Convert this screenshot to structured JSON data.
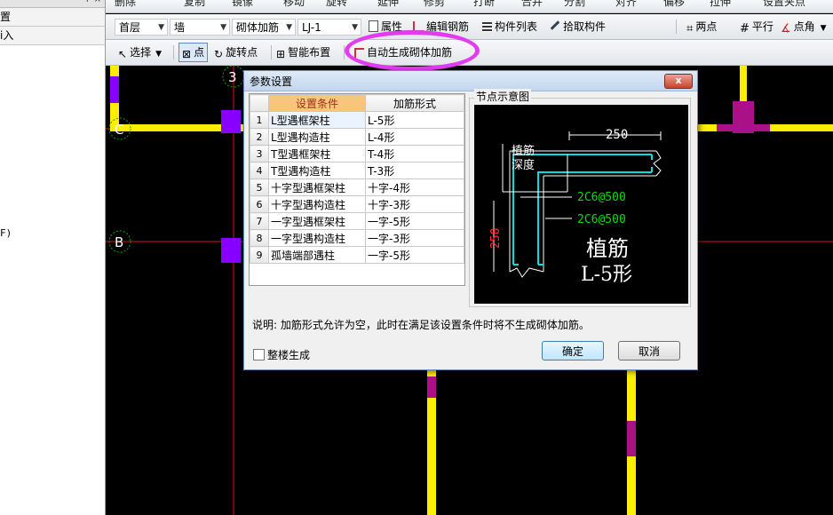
{
  "left_panel": {
    "row1": "置",
    "row2": "i入",
    "note": "F)",
    "close": "+ ×"
  },
  "toolbar1": {
    "items": [
      "删除",
      "复制",
      "镜像",
      "移动",
      "旋转",
      "延伸",
      "修剪",
      "打断",
      "合并",
      "分割",
      "对齐",
      "偏移",
      "拉伸",
      "设置夹点"
    ]
  },
  "toolbar2": {
    "floor": "首层",
    "category": "墙",
    "type": "砌体加筋",
    "component": "LJ-1",
    "attr": "属性",
    "edit_rebar": "编辑钢筋",
    "list": "构件列表",
    "pick": "拾取构件",
    "two_points": "两点",
    "parallel": "平行",
    "point_angle": "点角"
  },
  "toolbar3": {
    "select": "选择",
    "point": "点",
    "rotate_point": "旋转点",
    "smart": "智能布置",
    "auto": "自动生成砌体加筋"
  },
  "axes": {
    "a3": "3",
    "aC": "C",
    "aB": "B"
  },
  "dialog": {
    "title": "参数设置",
    "close": "x",
    "col_condition": "设置条件",
    "col_form": "加筋形式",
    "rows": [
      {
        "n": "1",
        "cond": "L型遇框架柱",
        "form": "L-5形"
      },
      {
        "n": "2",
        "cond": "L型遇构造柱",
        "form": "L-4形"
      },
      {
        "n": "3",
        "cond": "T型遇框架柱",
        "form": "T-4形"
      },
      {
        "n": "4",
        "cond": "T型遇构造柱",
        "form": "T-3形"
      },
      {
        "n": "5",
        "cond": "十字型遇框架柱",
        "form": "十字-4形"
      },
      {
        "n": "6",
        "cond": "十字型遇构造柱",
        "form": "十字-3形"
      },
      {
        "n": "7",
        "cond": "一字型遇框架柱",
        "form": "一字-5形"
      },
      {
        "n": "8",
        "cond": "一字型遇构造柱",
        "form": "一字-3形"
      },
      {
        "n": "9",
        "cond": "孤墙端部遇柱",
        "form": "一字-5形"
      }
    ],
    "diagram_label": "节点示意图",
    "diagram": {
      "dim_top": "250",
      "dim_left": "250",
      "anchor1": "植筋",
      "anchor2": "深度",
      "rebar1": "2C6@500",
      "rebar2": "2C6@500",
      "big1": "植筋",
      "big2": "L-5形"
    },
    "note": "说明: 加筋形式允许为空，此时在满足该设置条件时将不生成砌体加筋。",
    "checkbox": "整楼生成",
    "ok": "确定",
    "cancel": "取消"
  },
  "colors": {
    "wall": "#ffee00",
    "column": "#8800ff",
    "axis": "#e01010",
    "rebar": "#00e0e0",
    "highlight": "#e33cf0"
  }
}
